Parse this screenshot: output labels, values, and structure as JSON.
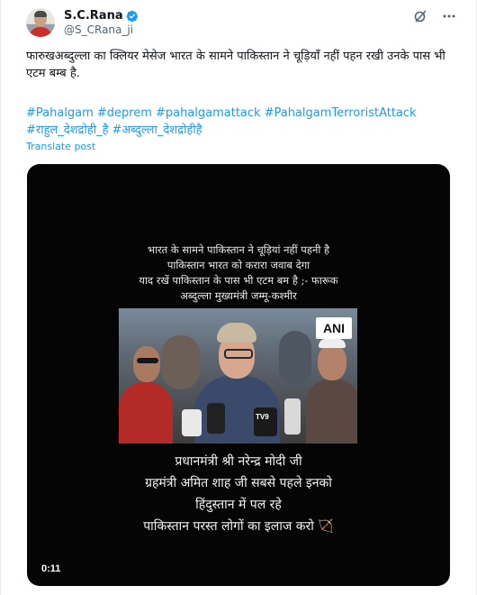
{
  "author": {
    "name": "S.C.Rana",
    "handle": "@S_CRana_ji",
    "verified_color": "#1d9bf0"
  },
  "icons": {
    "grok": "grok-icon",
    "more": "more-icon"
  },
  "post": {
    "text": "फारुखअब्दुल्ला का क्लियर मेसेज भारत के सामने पाकिस्तान ने चूड़ियाँ नहीं पहन रखी उनके पास भी एटम बम्ब है.",
    "hashtags": [
      "#Pahalgam",
      "#deprem",
      "#pahalgamattack",
      "#PahalgamTerroristAttack",
      "#राहुल_देशद्रोही_है",
      "#अब्दुल्ला_देशद्रोहीहै"
    ],
    "translate_label": "Translate post"
  },
  "video": {
    "caption_top": [
      "भारत के सामने पाकिस्तान ने चूड़ियां नहीं पहनी है",
      "पाकिस्तान भारत को करारा जवाब देगा",
      "याद रखें पाकिस्तान के पास भी एटम बम है ;- फारूक",
      "अब्दुल्ला मुख्यमंत्री जम्मू-कश्मीर"
    ],
    "agency_logo": "ANI",
    "mic_label": "TV9",
    "caption_bottom": [
      "प्रधानमंत्री श्री नरेन्द्र मोदी जी",
      "ग्रहमंत्री अमित शाह जी सबसे पहले इनको",
      "हिंदुस्तान में पल रहे",
      "पाकिस्तान परस्त लोगों का इलाज करो"
    ],
    "bow_emoji": "🏹",
    "timestamp": "0:11"
  },
  "colors": {
    "link": "#1d9bf0",
    "text": "#0f1419",
    "muted": "#536471"
  }
}
